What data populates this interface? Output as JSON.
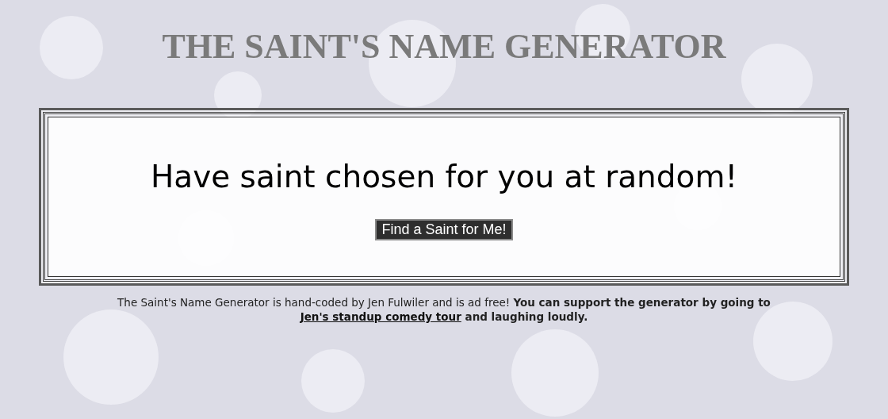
{
  "title": "THE SAINT'S NAME GENERATOR",
  "card": {
    "heading": "Have saint chosen for you at random!",
    "button": "Find a Saint for Me!"
  },
  "footer": {
    "text": "The Saint's Name Generator is hand-coded by Jen Fulwiler and is ad free!",
    "bold_text": "You can support the generator by going to",
    "link": "Jen's standup comedy tour",
    "bold_after": "and laughing loudly."
  }
}
